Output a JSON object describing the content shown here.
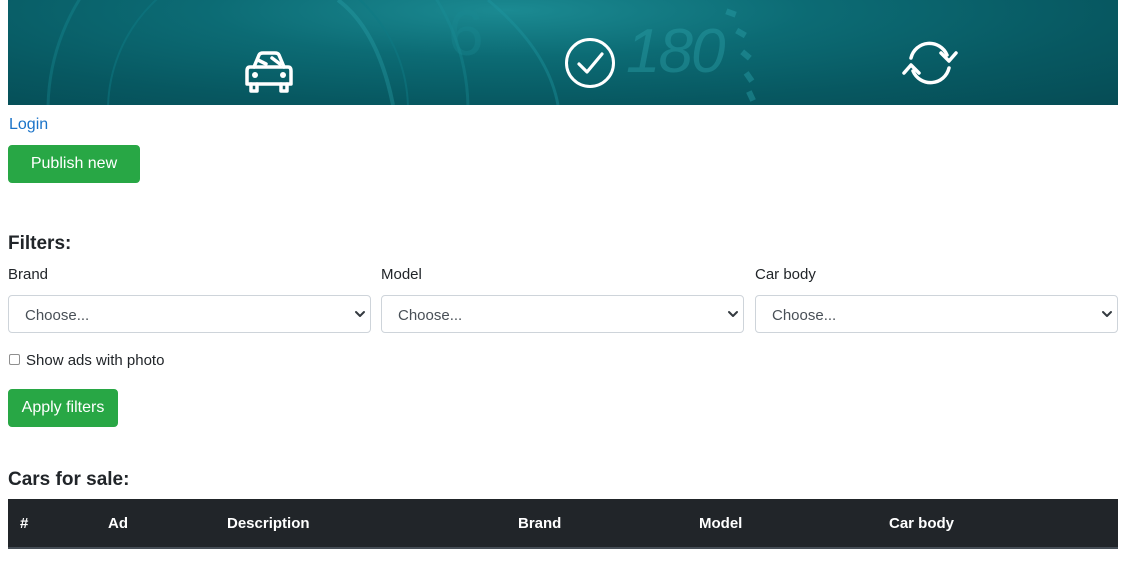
{
  "header": {
    "icons": [
      "car-icon",
      "check-circle-icon",
      "refresh-icon"
    ],
    "banner_text": "180",
    "colors": {
      "banner": "#075861",
      "accent": "#0c6b74"
    }
  },
  "nav": {
    "login_label": "Login"
  },
  "actions": {
    "publish_label": "Publish new ad"
  },
  "filters": {
    "title": "Filters:",
    "fields": [
      {
        "label": "Brand",
        "value": "Choose..."
      },
      {
        "label": "Model",
        "value": "Choose..."
      },
      {
        "label": "Car body",
        "value": "Choose..."
      }
    ],
    "photo_checkbox_label": "Show ads with photo",
    "photo_checkbox_checked": false,
    "apply_label": "Apply filters"
  },
  "cars": {
    "title": "Cars for sale:",
    "columns": [
      "#",
      "Ad",
      "Description",
      "Brand",
      "Model",
      "Car body"
    ]
  },
  "colors": {
    "button": "#28a745",
    "link": "#1a73c8",
    "table_header": "#212529"
  }
}
